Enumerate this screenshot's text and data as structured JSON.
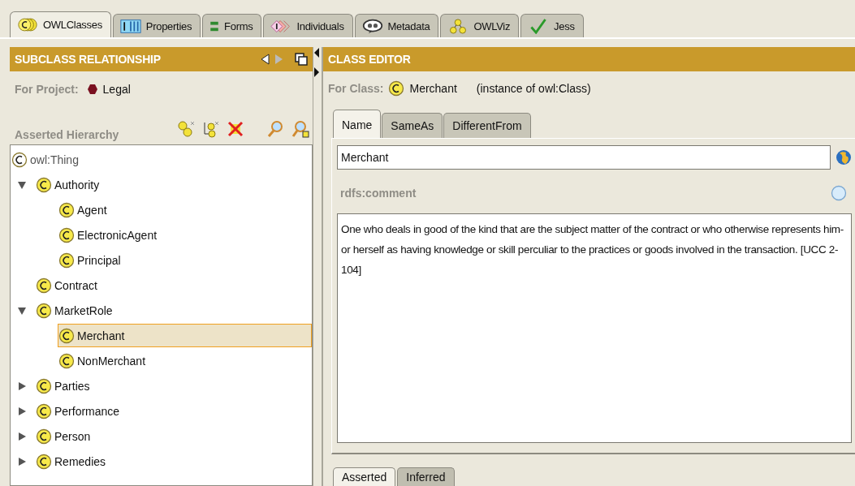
{
  "main_tabs": [
    {
      "label": "OWLClasses",
      "kind": "classes",
      "selected": true
    },
    {
      "label": "Properties",
      "kind": "properties",
      "selected": false
    },
    {
      "label": "Forms",
      "kind": "forms",
      "selected": false
    },
    {
      "label": "Individuals",
      "kind": "individuals",
      "selected": false
    },
    {
      "label": "Metadata",
      "kind": "metadata",
      "selected": false
    },
    {
      "label": "OWLViz",
      "kind": "owlviz",
      "selected": false
    },
    {
      "label": "Jess",
      "kind": "jess",
      "selected": false
    }
  ],
  "left_panel": {
    "title": "SUBCLASS RELATIONSHIP",
    "project_label": "For Project:",
    "project_name": "Legal",
    "hierarchy_label": "Asserted Hierarchy",
    "tree": [
      {
        "label": "owl:Thing",
        "selected": false,
        "children": [
          {
            "label": "Authority",
            "selected": false,
            "expanded": true,
            "children": [
              {
                "label": "Agent",
                "selected": false
              },
              {
                "label": "ElectronicAgent",
                "selected": false
              },
              {
                "label": "Principal",
                "selected": false
              }
            ]
          },
          {
            "label": "Contract",
            "selected": false
          },
          {
            "label": "MarketRole",
            "selected": false,
            "expanded": true,
            "children": [
              {
                "label": "Merchant",
                "selected": true
              },
              {
                "label": "NonMerchant",
                "selected": false
              }
            ]
          },
          {
            "label": "Parties",
            "selected": false,
            "expanded": false
          },
          {
            "label": "Performance",
            "selected": false,
            "expanded": false
          },
          {
            "label": "Person",
            "selected": false,
            "expanded": false
          },
          {
            "label": "Remedies",
            "selected": false,
            "expanded": false
          }
        ]
      }
    ]
  },
  "right_panel": {
    "title": "CLASS EDITOR",
    "class_label": "For Class:",
    "class_name": "Merchant",
    "class_type": "(instance of owl:Class)",
    "tabs": [
      {
        "label": "Name",
        "selected": true
      },
      {
        "label": "SameAs",
        "selected": false
      },
      {
        "label": "DifferentFrom",
        "selected": false
      }
    ],
    "name_value": "Merchant",
    "comment_label": "rdfs:comment",
    "comment": "One who deals in good of the kind that are the subject matter of the contract or who otherwise represents him- or herself as having knowledge or skill perculiar to the practices or goods involved in the transaction. [UCC 2-104]",
    "bottom_tabs": [
      {
        "label": "Asserted",
        "selected": true
      },
      {
        "label": "Inferred",
        "selected": false
      }
    ]
  }
}
